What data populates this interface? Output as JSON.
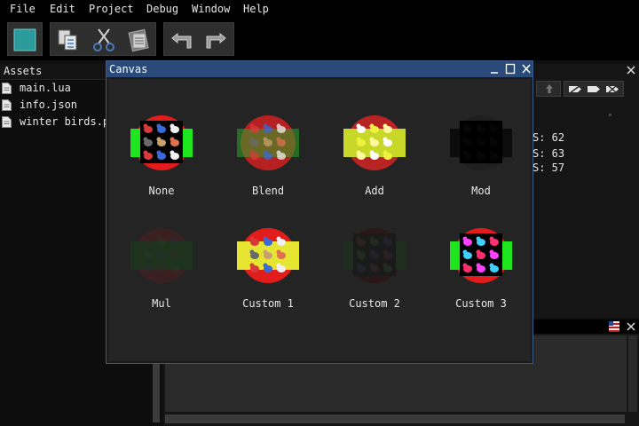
{
  "menu": [
    "File",
    "Edit",
    "Project",
    "Debug",
    "Window",
    "Help"
  ],
  "toolbar": {
    "buttons": [
      "stop",
      "copy",
      "cut",
      "paste",
      "undo",
      "redo"
    ]
  },
  "assets": {
    "title": "Assets",
    "files": [
      "main.lua",
      "info.json",
      "winter birds.p"
    ]
  },
  "inspector": {
    "stats": [
      "S: 62",
      "S: 63",
      "S: 57"
    ]
  },
  "canvas": {
    "title": "Canvas",
    "items": [
      {
        "label": "None"
      },
      {
        "label": "Blend"
      },
      {
        "label": "Add"
      },
      {
        "label": "Mod"
      },
      {
        "label": "Mul"
      },
      {
        "label": "Custom 1"
      },
      {
        "label": "Custom 2"
      },
      {
        "label": "Custom 3"
      }
    ]
  },
  "colors": {
    "window_title_bg": "#2a4a7a",
    "red_circle": "#e21b1b",
    "green_rect": "#1ee61e",
    "body_bg": "#242424"
  }
}
